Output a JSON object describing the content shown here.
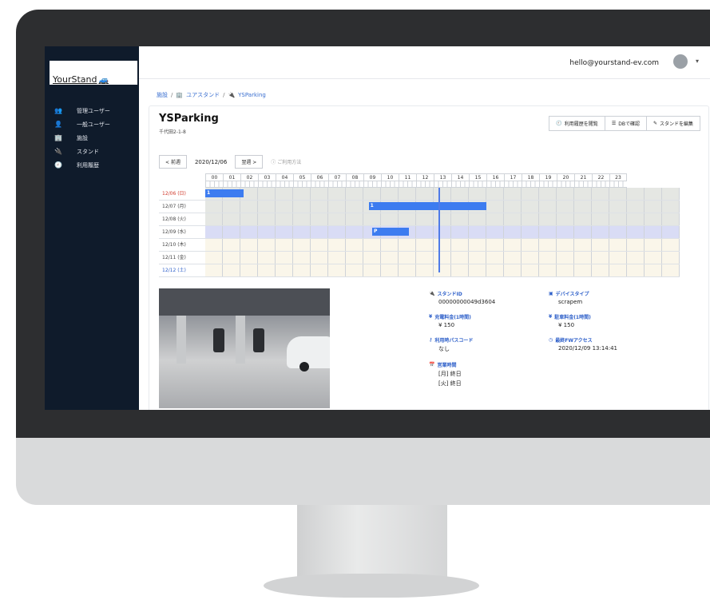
{
  "brand": {
    "name": "YourStand",
    "accent": "#3d7cf0",
    "sidebar_bg": "#0f1b2b"
  },
  "sidebar": {
    "items": [
      {
        "icon": "admin-users-icon",
        "glyph": "👥",
        "label": "管理ユーザー"
      },
      {
        "icon": "user-icon",
        "glyph": "👤",
        "label": "一般ユーザー"
      },
      {
        "icon": "building-icon",
        "glyph": "🏢",
        "label": "施設"
      },
      {
        "icon": "stand-icon",
        "glyph": "🔌",
        "label": "スタンド"
      },
      {
        "icon": "history-icon",
        "glyph": "🕘",
        "label": "利用履歴"
      }
    ]
  },
  "topbar": {
    "email": "hello@yourstand-ev.com"
  },
  "breadcrumb": {
    "item1": "施設",
    "item2": "ユアスタンド",
    "item3": "YSParking"
  },
  "stand": {
    "title": "YSParking",
    "address": "千代田2-1-8"
  },
  "actions": {
    "history": "利用履歴を閲覧",
    "db": "DBで確認",
    "edit": "スタンドを編集"
  },
  "datenav": {
    "prev": "前週",
    "date": "2020/12/06",
    "next": "翌週",
    "howto": "ご利用方法"
  },
  "schedule": {
    "hours": [
      "00",
      "01",
      "02",
      "03",
      "04",
      "05",
      "06",
      "07",
      "08",
      "09",
      "10",
      "11",
      "12",
      "13",
      "14",
      "15",
      "16",
      "17",
      "18",
      "19",
      "20",
      "21",
      "22",
      "23"
    ],
    "days": [
      {
        "label": "12/06 (日)",
        "color": "#d0392b",
        "bg": "#e5e7e3"
      },
      {
        "label": "12/07 (月)",
        "color": "#444444",
        "bg": "#e5e7e3"
      },
      {
        "label": "12/08 (火)",
        "color": "#444444",
        "bg": "#e5e7e3"
      },
      {
        "label": "12/09 (水)",
        "color": "#444444",
        "bg": "#d9dcf5"
      },
      {
        "label": "12/10 (木)",
        "color": "#444444",
        "bg": "#faf6ea"
      },
      {
        "label": "12/11 (金)",
        "color": "#444444",
        "bg": "#faf6ea"
      },
      {
        "label": "12/12 (土)",
        "color": "#2d5fc9",
        "bg": "#faf6ea"
      }
    ],
    "bookings": [
      {
        "day": 0,
        "start": 0.0,
        "end": 2.2,
        "tag": "1"
      },
      {
        "day": 1,
        "start": 9.3,
        "end": 16.0,
        "tag": "1"
      },
      {
        "day": 3,
        "start": 9.5,
        "end": 11.6,
        "tag": "P"
      }
    ],
    "now_hour": 13.25
  },
  "info": {
    "stand_id": {
      "label": "スタンドID",
      "value": "00000000049d3604"
    },
    "device_type": {
      "label": "デバイスタイプ",
      "value": "scrapem"
    },
    "charge_fee": {
      "label": "充電料金(1時間)",
      "value": "¥ 150"
    },
    "parking_fee": {
      "label": "駐車料金(1時間)",
      "value": "¥ 150"
    },
    "passcode": {
      "label": "利用時パスコード",
      "value": "なし"
    },
    "last_access": {
      "label": "最終FWアクセス",
      "value": "2020/12/09 13:14:41"
    },
    "hours": {
      "label": "営業時間",
      "mon": "[月] 終日",
      "tue": "[火] 終日"
    }
  }
}
